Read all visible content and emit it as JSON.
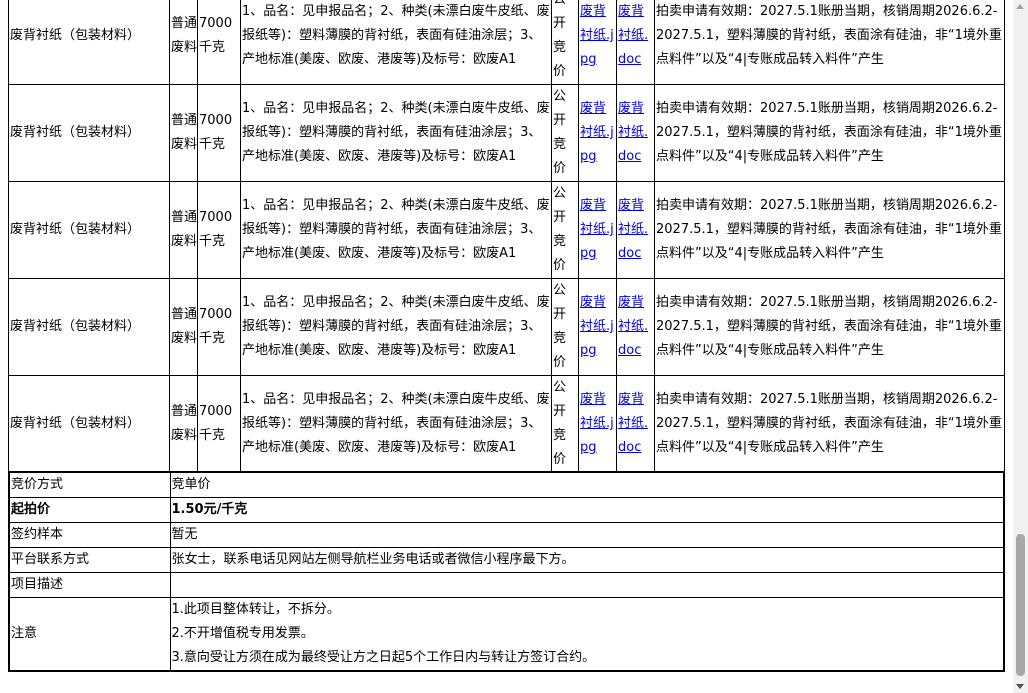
{
  "items": [
    {
      "name": "废背衬纸（包装材料）",
      "category": "普通废料",
      "quantity": "7000千克",
      "spec": "1、品名：见申报品名；2、种类(未漂白废牛皮纸、废报纸等)：塑料薄膜的背衬纸，表面有硅油涂层；3、产地标准(美废、欧废、港废等)及标号：欧废A1",
      "method": "公开竞价",
      "image_link": "废背衬纸.jpg",
      "doc_link": "废背衬纸.doc",
      "remark": "拍卖申请有效期：2027.5.1账册当期，核销周期2026.6.2-2027.5.1，塑料薄膜的背衬纸，表面涂有硅油，非“1境外重点料件”以及“4|专账成品转入料件”产生"
    },
    {
      "name": "废背衬纸（包装材料）",
      "category": "普通废料",
      "quantity": "7000千克",
      "spec": "1、品名：见申报品名；2、种类(未漂白废牛皮纸、废报纸等)：塑料薄膜的背衬纸，表面有硅油涂层；3、产地标准(美废、欧废、港废等)及标号：欧废A1",
      "method": "公开竞价",
      "image_link": "废背衬纸.jpg",
      "doc_link": "废背衬纸.doc",
      "remark": "拍卖申请有效期：2027.5.1账册当期，核销周期2026.6.2-2027.5.1，塑料薄膜的背衬纸，表面涂有硅油，非“1境外重点料件”以及“4|专账成品转入料件”产生"
    },
    {
      "name": "废背衬纸（包装材料）",
      "category": "普通废料",
      "quantity": "7000千克",
      "spec": "1、品名：见申报品名；2、种类(未漂白废牛皮纸、废报纸等)：塑料薄膜的背衬纸，表面有硅油涂层；3、产地标准(美废、欧废、港废等)及标号：欧废A1",
      "method": "公开竞价",
      "image_link": "废背衬纸.jpg",
      "doc_link": "废背衬纸.doc",
      "remark": "拍卖申请有效期：2027.5.1账册当期，核销周期2026.6.2-2027.5.1，塑料薄膜的背衬纸，表面涂有硅油，非“1境外重点料件”以及“4|专账成品转入料件”产生"
    },
    {
      "name": "废背衬纸（包装材料）",
      "category": "普通废料",
      "quantity": "7000千克",
      "spec": "1、品名：见申报品名；2、种类(未漂白废牛皮纸、废报纸等)：塑料薄膜的背衬纸，表面有硅油涂层；3、产地标准(美废、欧废、港废等)及标号：欧废A1",
      "method": "公开竞价",
      "image_link": "废背衬纸.jpg",
      "doc_link": "废背衬纸.doc",
      "remark": "拍卖申请有效期：2027.5.1账册当期，核销周期2026.6.2-2027.5.1，塑料薄膜的背衬纸，表面涂有硅油，非“1境外重点料件”以及“4|专账成品转入料件”产生"
    },
    {
      "name": "废背衬纸（包装材料）",
      "category": "普通废料",
      "quantity": "7000千克",
      "spec": "1、品名：见申报品名；2、种类(未漂白废牛皮纸、废报纸等)：塑料薄膜的背衬纸，表面有硅油涂层；3、产地标准(美废、欧废、港废等)及标号：欧废A1",
      "method": "公开竞价",
      "image_link": "废背衬纸.jpg",
      "doc_link": "废背衬纸.doc",
      "remark": "拍卖申请有效期：2027.5.1账册当期，核销周期2026.6.2-2027.5.1，塑料薄膜的背衬纸，表面涂有硅油，非“1境外重点料件”以及“4|专账成品转入料件”产生"
    }
  ],
  "info": {
    "bid_method_label": "竞价方式",
    "bid_method_value": "竞单价",
    "start_price_label": "起拍价",
    "start_price_value": "1.50元/千克",
    "contract_sample_label": "签约样本",
    "contract_sample_value": "暂无",
    "contact_label": "平台联系方式",
    "contact_value": "张女士，联系电话见网站左侧导航栏业务电话或者微信小程序最下方。",
    "description_label": "项目描述",
    "description_value": "",
    "notes_label": "注意",
    "notes": [
      "1.此项目整体转让，不拆分。",
      "2.不开增值税专用发票。",
      "3.意向受让方须在成为最终受让方之日起5个工作日内与转让方签订合约。"
    ]
  },
  "scroll": {
    "position_fraction": 0.79
  }
}
